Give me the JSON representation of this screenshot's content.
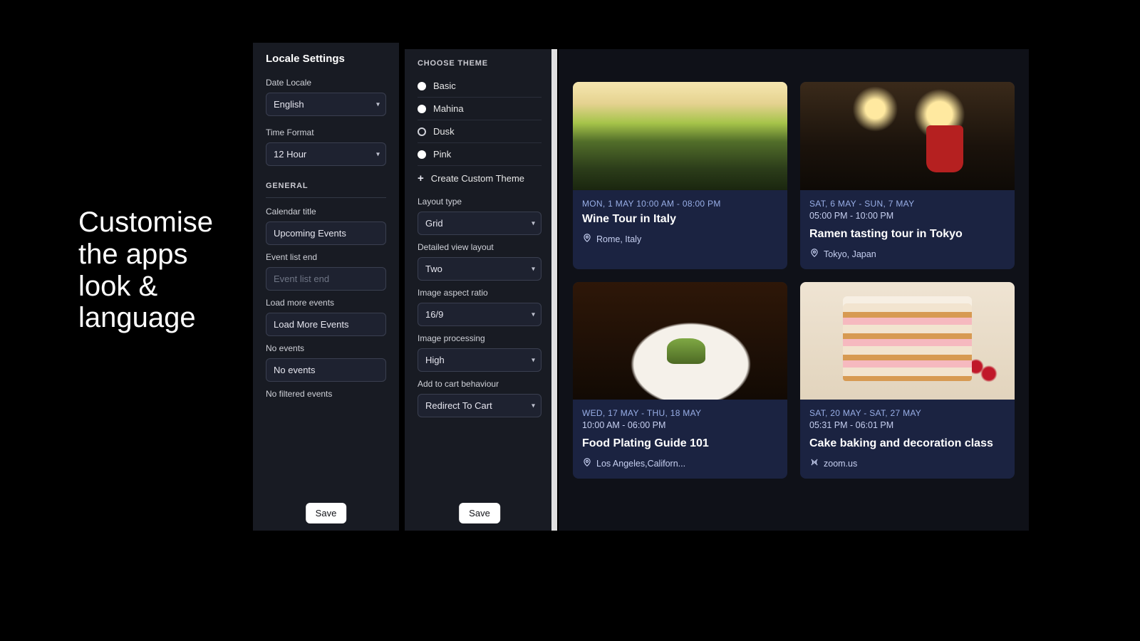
{
  "tagline": "Customise the apps look & language",
  "locale_panel": {
    "title": "Locale Settings",
    "date_locale_label": "Date Locale",
    "date_locale_value": "English",
    "time_format_label": "Time Format",
    "time_format_value": "12 Hour",
    "general_section": "GENERAL",
    "calendar_title_label": "Calendar title",
    "calendar_title_value": "Upcoming Events",
    "event_list_end_label": "Event list end",
    "event_list_end_placeholder": "Event list end",
    "load_more_label": "Load more events",
    "load_more_value": "Load More Events",
    "no_events_label": "No events",
    "no_events_value": "No events",
    "no_filtered_label": "No filtered events",
    "save": "Save"
  },
  "theme_panel": {
    "choose_theme": "CHOOSE THEME",
    "themes": [
      "Basic",
      "Mahina",
      "Dusk",
      "Pink"
    ],
    "selected": "Dusk",
    "create_custom": "Create Custom Theme",
    "layout_type_label": "Layout type",
    "layout_type_value": "Grid",
    "detailed_view_label": "Detailed view layout",
    "detailed_view_value": "Two",
    "aspect_label": "Image aspect ratio",
    "aspect_value": "16/9",
    "processing_label": "Image processing",
    "processing_value": "High",
    "cart_label": "Add to cart behaviour",
    "cart_value": "Redirect To Cart",
    "save": "Save"
  },
  "events": [
    {
      "date_line": "MON, 1 MAY",
      "time_line": "10:00 AM - 08:00 PM",
      "inline_time": true,
      "title": "Wine Tour in Italy",
      "loc": "Rome, Italy",
      "loc_icon": "pin",
      "img_class": "img-vineyard"
    },
    {
      "date_line": "SAT, 6 MAY - SUN, 7 MAY",
      "time_line": "05:00 PM - 10:00 PM",
      "inline_time": false,
      "title": "Ramen tasting tour in Tokyo",
      "loc": "Tokyo, Japan",
      "loc_icon": "pin",
      "img_class": "img-ramen"
    },
    {
      "date_line": "WED, 17 MAY - THU, 18 MAY",
      "time_line": "10:00 AM - 06:00 PM",
      "inline_time": false,
      "title": "Food Plating Guide 101",
      "loc": "Los Angeles,Californ...",
      "loc_icon": "pin",
      "img_class": "img-plating"
    },
    {
      "date_line": "SAT, 20 MAY - SAT, 27 MAY",
      "time_line": "05:31 PM - 06:01 PM",
      "inline_time": false,
      "title": "Cake baking and decoration class",
      "loc": "zoom.us",
      "loc_icon": "wifi",
      "img_class": "img-cake"
    }
  ]
}
